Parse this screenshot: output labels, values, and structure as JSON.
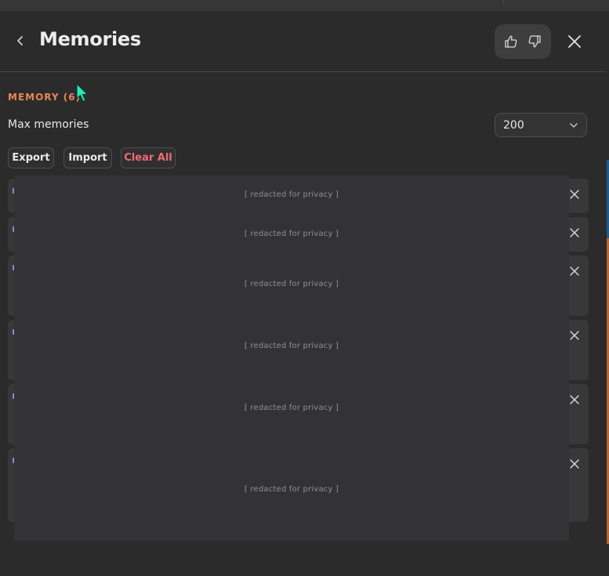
{
  "header": {
    "title": "Memories",
    "back_icon": "chevron-left-icon",
    "like_icon": "thumbs-up-icon",
    "dislike_icon": "thumbs-down-icon",
    "close_icon": "close-icon"
  },
  "memory": {
    "section_label": "MEMORY (6)",
    "max_label": "Max memories",
    "max_value": "200",
    "export_label": "Export",
    "import_label": "Import",
    "clear_label": "Clear All"
  },
  "items": [
    {
      "text": "[ redacted for privacy ]"
    },
    {
      "text": "[ redacted for privacy ]"
    },
    {
      "text": "[ redacted for privacy ]"
    },
    {
      "text": "[ redacted for privacy ]"
    },
    {
      "text": "[ redacted for privacy ]"
    },
    {
      "text": "[ redacted for privacy ]"
    }
  ],
  "colors": {
    "background": "#2b2b2b",
    "accent_label": "#e8845a",
    "danger": "#f06a78",
    "card": "#383838",
    "cursor": "#2ee6b6"
  }
}
